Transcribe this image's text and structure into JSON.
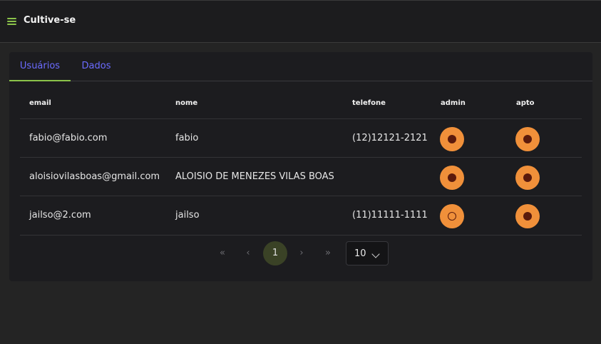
{
  "app": {
    "title": "Cultive-se",
    "menu_icon": "hamburger-menu-icon",
    "accent": "#8bc34a"
  },
  "tabs": [
    {
      "label": "Usuários",
      "active": true
    },
    {
      "label": "Dados",
      "active": false
    }
  ],
  "table": {
    "columns": [
      "email",
      "nome",
      "telefone",
      "admin",
      "apto"
    ],
    "rows": [
      {
        "email": "fabio@fabio.com",
        "nome": "fabio",
        "telefone": "(12)12121-2121",
        "admin": true,
        "apto": true
      },
      {
        "email": "aloisiovilasboas@gmail.com",
        "nome": "ALOISIO DE MENEZES VILAS BOAS",
        "telefone": "",
        "admin": true,
        "apto": true
      },
      {
        "email": "jailso@2.com",
        "nome": "jailso",
        "telefone": "(11)11111-1111",
        "admin": false,
        "apto": true
      }
    ]
  },
  "pagination": {
    "first": "«",
    "prev": "‹",
    "current_page": "1",
    "next": "›",
    "last": "»",
    "page_size": "10"
  },
  "colors": {
    "radio": "#f0903a",
    "radio_dot": "#5a1a0c",
    "tab_text": "#6b6bff"
  }
}
